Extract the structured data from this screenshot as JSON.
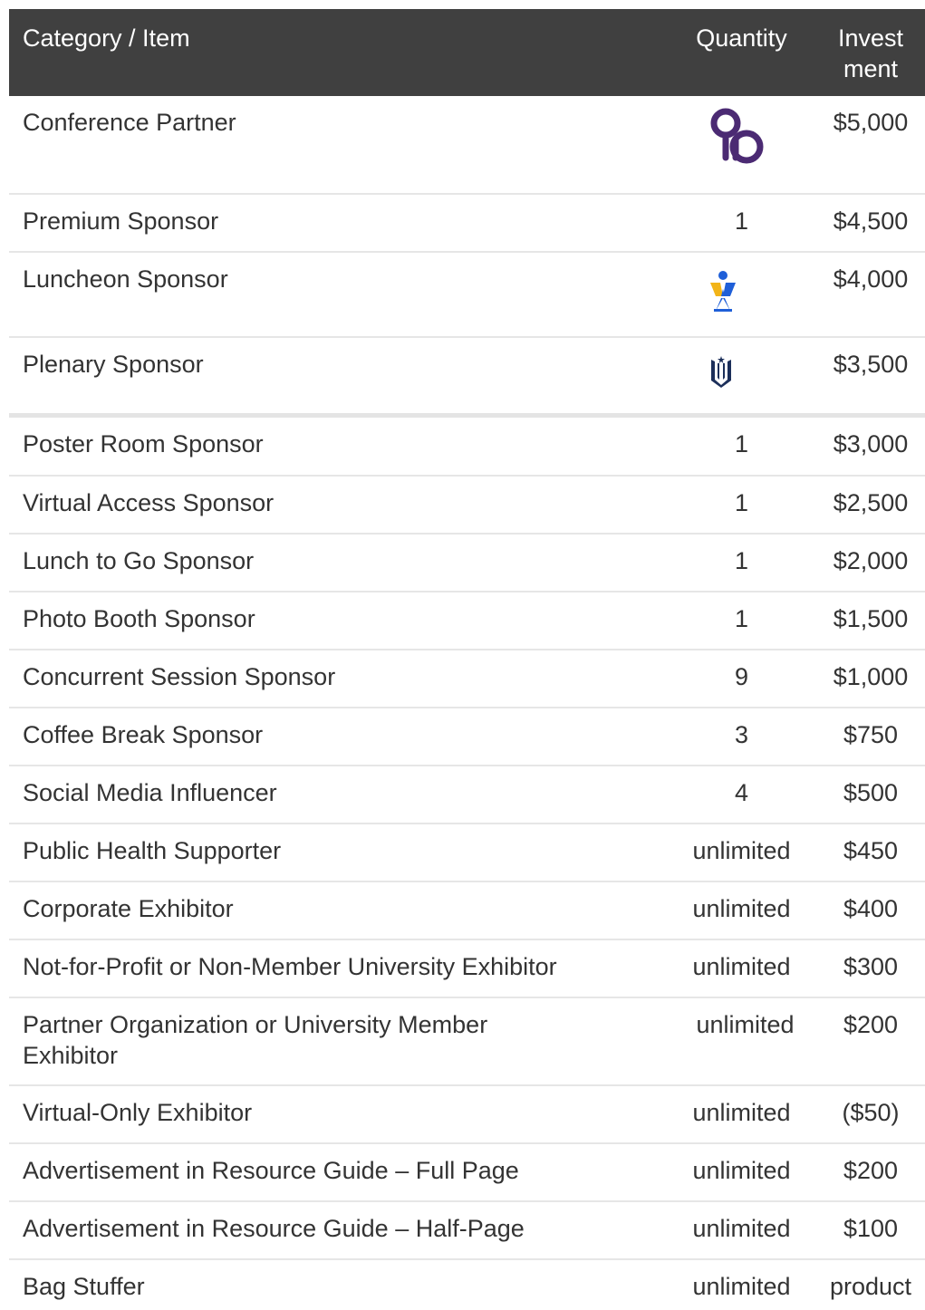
{
  "header": {
    "col_item": "Category / Item",
    "col_quantity": "Quantity",
    "col_investment": "Invest ment"
  },
  "rows": [
    {
      "item": "Conference Partner",
      "quantity": "",
      "investment": "$5,000",
      "quantity_icon": "partner-logo-icon"
    },
    {
      "item": "Premium Sponsor",
      "quantity": "1",
      "investment": "$4,500"
    },
    {
      "item": "Luncheon Sponsor",
      "quantity": "",
      "investment": "$4,000",
      "quantity_icon": "sponsor-figure-logo-icon"
    },
    {
      "item": "Plenary Sponsor",
      "quantity": "",
      "investment": "$3,500",
      "quantity_icon": "university-shield-logo-icon"
    },
    {
      "item": "Poster Room Sponsor",
      "quantity": "1",
      "investment": "$3,000"
    },
    {
      "item": "Virtual Access Sponsor",
      "quantity": "1",
      "investment": "$2,500"
    },
    {
      "item": "Lunch to Go Sponsor",
      "quantity": "1",
      "investment": "$2,000"
    },
    {
      "item": "Photo Booth Sponsor",
      "quantity": "1",
      "investment": "$1,500"
    },
    {
      "item": "Concurrent Session Sponsor",
      "quantity": "9",
      "investment": "$1,000"
    },
    {
      "item": "Coffee Break Sponsor",
      "quantity": "3",
      "investment": "$750"
    },
    {
      "item": "Social Media Influencer",
      "quantity": "4",
      "investment": "$500"
    },
    {
      "item": "Public Health Supporter",
      "quantity": "unlimited",
      "investment": "$450"
    },
    {
      "item": "Corporate Exhibitor",
      "quantity": "unlimited",
      "investment": "$400"
    },
    {
      "item": "Not-for-Profit or Non-Member University Exhibitor",
      "quantity": "unlimited",
      "investment": "$300"
    },
    {
      "item": "Partner Organization or University Member Exhibitor",
      "quantity": "unlimited",
      "investment": "$200"
    },
    {
      "item": "Virtual-Only Exhibitor",
      "quantity": "unlimited",
      "investment": "($50)"
    },
    {
      "item": "Advertisement in Resource Guide – Full Page",
      "quantity": "unlimited",
      "investment": "$200"
    },
    {
      "item": "Advertisement in Resource Guide – Half-Page",
      "quantity": "unlimited",
      "investment": "$100"
    },
    {
      "item": "Bag Stuffer",
      "quantity": "unlimited",
      "investment": "product"
    }
  ],
  "colors": {
    "header_bg": "#404040",
    "header_text": "#ffffff",
    "text": "#333333",
    "divider": "#e6e6e6",
    "partner_logo": "#4b2a73",
    "sponsor_blue": "#1f5fd8",
    "sponsor_gold": "#f2b418",
    "shield_navy": "#1c2f5a"
  }
}
